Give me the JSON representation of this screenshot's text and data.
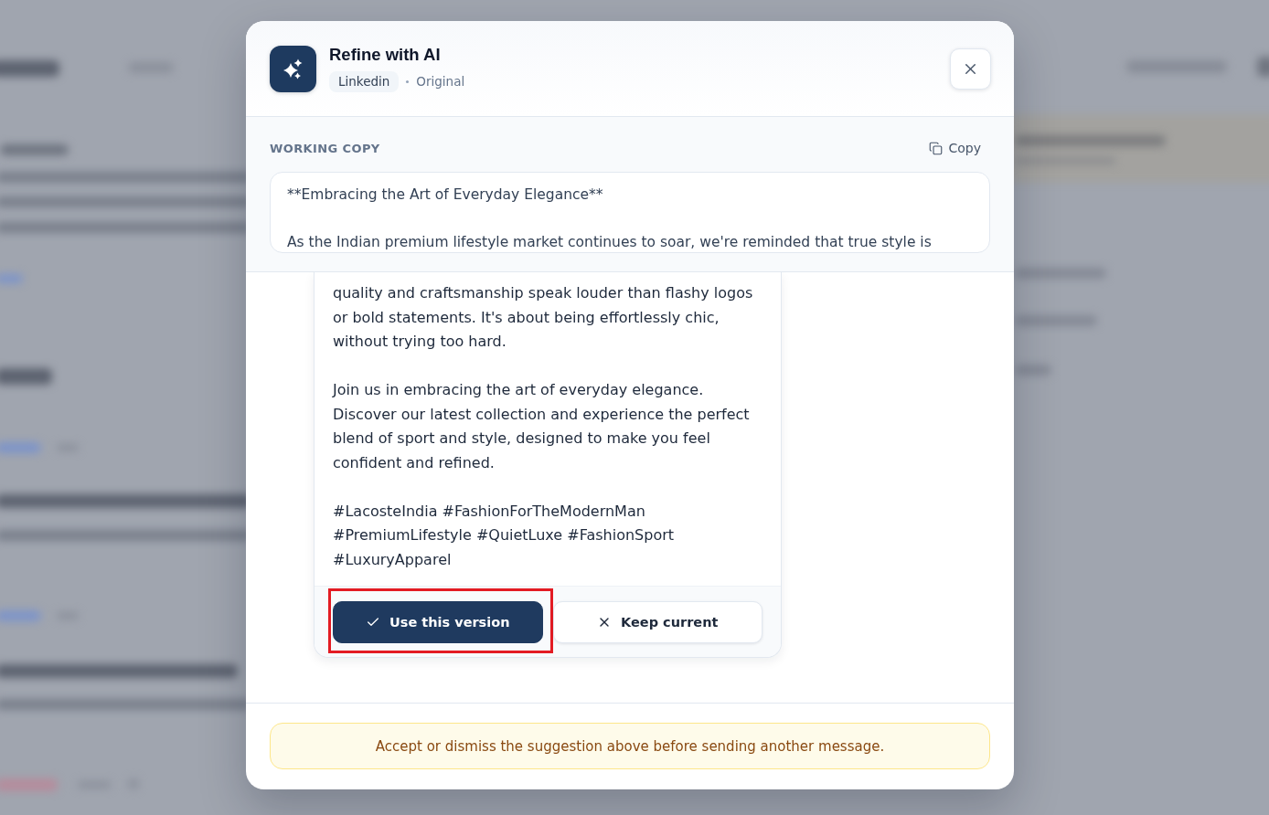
{
  "dialog": {
    "title": "Refine with AI",
    "platform_chip": "Linkedin",
    "version_label": "Original"
  },
  "working_copy": {
    "label": "WORKING COPY",
    "copy_button": "Copy",
    "text": "**Embracing the Art of Everyday Elegance**\n\nAs the Indian premium lifestyle market continues to soar, we're reminded that true style is"
  },
  "suggestion": {
    "paragraphs": [
      "quality and craftsmanship speak louder than flashy logos or bold statements. It's about being effortlessly chic, without trying too hard.",
      "Join us in embracing the art of everyday elegance. Discover our latest collection and experience the perfect blend of sport and style, designed to make you feel confident and refined.",
      "#LacosteIndia #FashionForTheModernMan #PremiumLifestyle #QuietLuxe #FashionSport #LuxuryApparel"
    ],
    "actions": [
      {
        "kind": "accept",
        "label": "Use this version",
        "highlighted": true
      },
      {
        "kind": "dismiss",
        "label": "Keep current",
        "highlighted": false
      }
    ]
  },
  "notice": "Accept or dismiss the suggestion above before sending another message."
}
